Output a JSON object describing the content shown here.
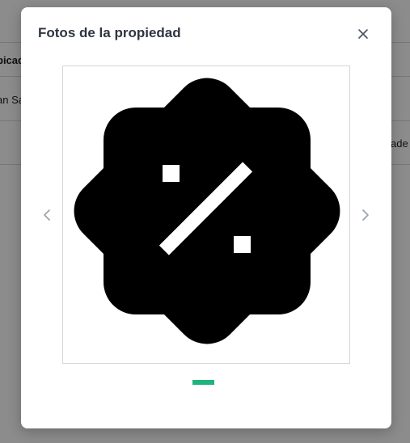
{
  "background": {
    "table_header_fragment": "bicad",
    "table_cell_fragment": "an Sa",
    "right_fragment": "ade"
  },
  "modal": {
    "title": "Fotos de la propiedad",
    "current_slide": 1,
    "total_slides": 1
  },
  "icons": {
    "close": "close-icon",
    "prev": "chevron-left-icon",
    "next": "chevron-right-icon",
    "image": "discount-badge-icon"
  },
  "colors": {
    "indicator": "#1db47d",
    "title": "#2f3441"
  }
}
